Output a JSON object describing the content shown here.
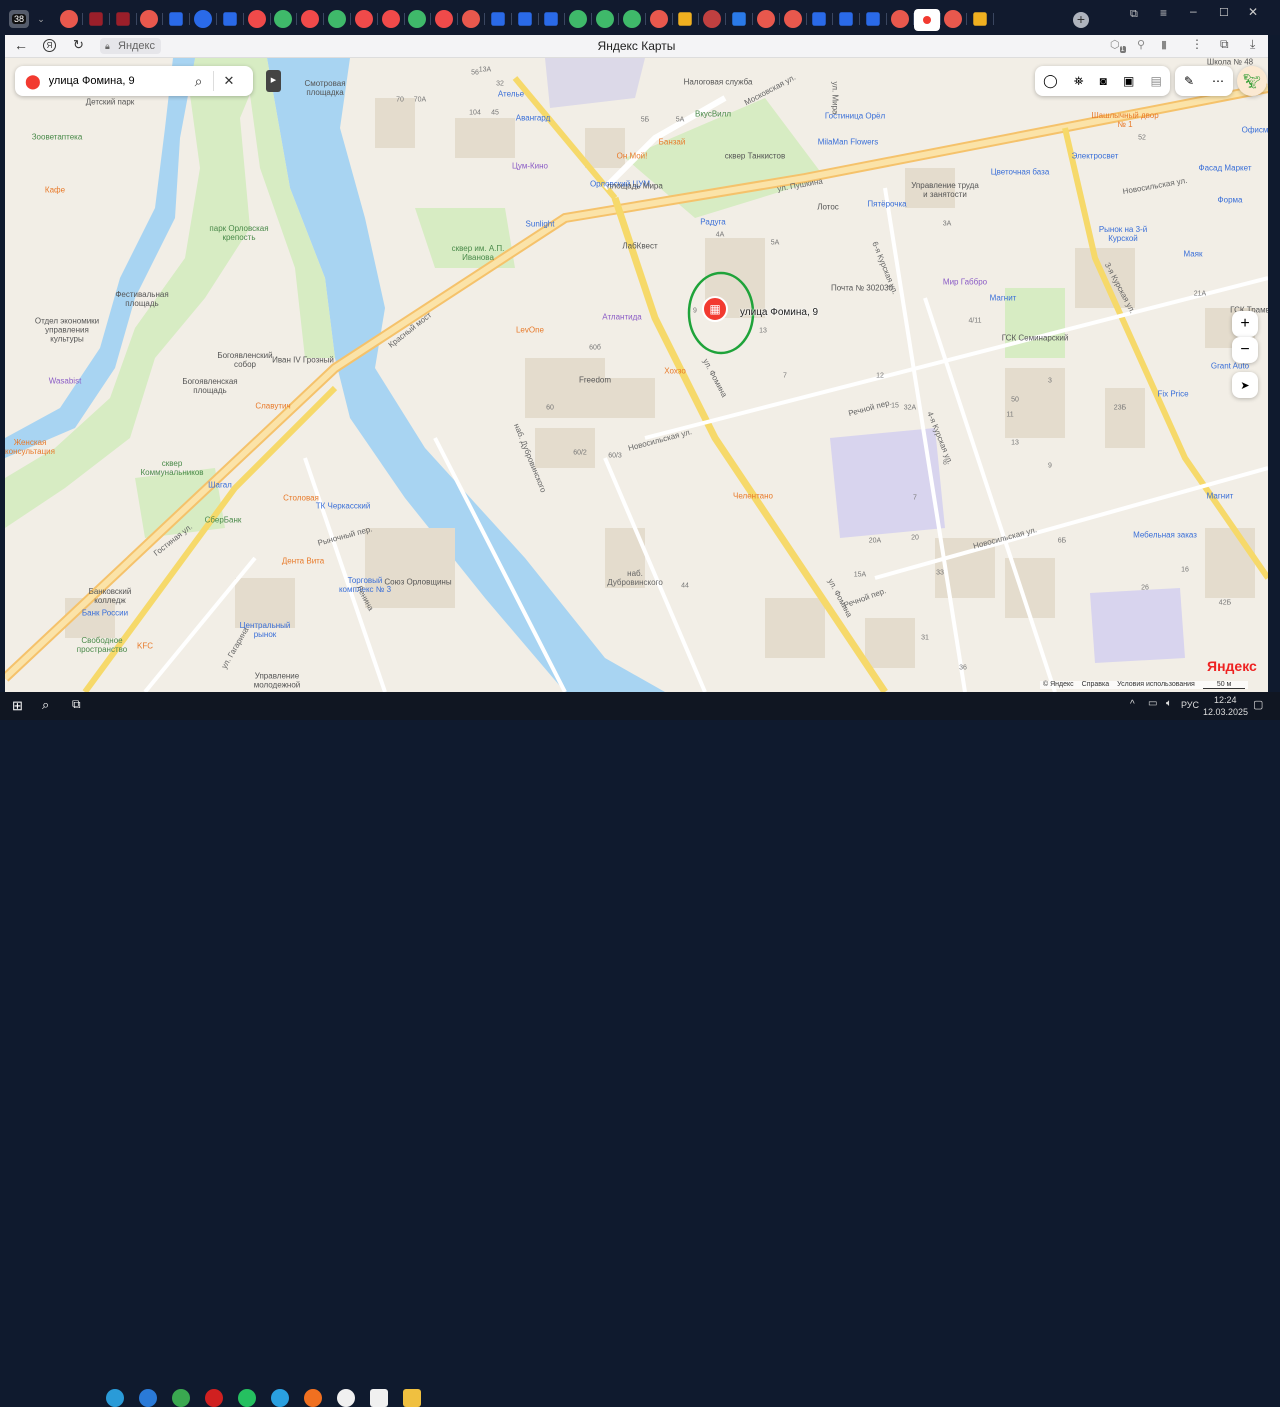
{
  "browser": {
    "tab_count": "38",
    "tabs": [
      "yandex",
      "calendar",
      "calendar",
      "yandex",
      "nav",
      "p1",
      "nav",
      "red-dot",
      "cluster",
      "red-dot",
      "cluster",
      "red-dot",
      "red-dot",
      "cluster",
      "red-dot",
      "yandex",
      "nav",
      "nav",
      "nav",
      "cluster",
      "cluster",
      "cluster",
      "yandex",
      "picture",
      "hoop",
      "vk",
      "yandex",
      "yandex",
      "nav",
      "nav",
      "nav",
      "yandex",
      "yandex-maps-active",
      "yandex",
      "picture"
    ],
    "site_label": "Яндекс",
    "page_title": "Яндекс Карты",
    "address_badge": "1"
  },
  "search": {
    "value": "улица Фомина, 9"
  },
  "marker": {
    "label": "улица Фомина, 9",
    "color": "#f23a30",
    "highlight": "#1fa33a"
  },
  "map_labels": [
    "Смотровая площадка",
    "Ателье",
    "Авангард",
    "Цум-Кино",
    "Орловский ЦУМ",
    "Sunlight",
    "ЛабКвест",
    "Налоговая служба",
    "ВкусВилл",
    "Банзай",
    "Он Мой!",
    "сквер Танкистов",
    "Московская ул.",
    "Гостиница Орёл",
    "MilaMan Flowers",
    "ул. Пушкина",
    "Пятёрочка",
    "Управление труда и занятости",
    "Цветочная база",
    "Лотос",
    "Электросвет",
    "Шашлычный двор № 1",
    "Экспресс Ломбард",
    "Школа № 48",
    "Офисм",
    "Фасад Маркет",
    "Форма",
    "Новосильская ул.",
    "Рынок на 3-й Курской",
    "Маяк",
    "Радуга",
    "Атлантида",
    "LevOne",
    "Freedom",
    "Хохзо",
    "ул. Фомина",
    "Почта № 302030",
    "Мир Габбро",
    "Магнит",
    "ГСК Семинарский",
    "ГСК Трамв",
    "Grant Auto",
    "Fix Price",
    "Красный мост",
    "Иван IV Грозный",
    "Богоявленский собор",
    "Богоявленская площадь",
    "парк Орловская крепость",
    "сквер им. А.П. Иванова",
    "Отдел экономики управления культуры",
    "Фестивальная площадь",
    "Зооветаптека",
    "Кафе",
    "Детский парк",
    "Wasabist",
    "Славутич",
    "Шагал",
    "сквер Коммунальников",
    "Женская консультация",
    "СберБанк",
    "Столовая",
    "ТК Черкасский",
    "Дента Вита",
    "Торговый комплекс № 3",
    "Союз Орловщины",
    "Центральный рынок",
    "Свободное пространство",
    "Банковский колледж",
    "Банк России",
    "KFC",
    "Управление молодежной политики",
    "Гостиная ул.",
    "Челентано",
    "Магнит",
    "Мебельная заказ",
    "Речной пер.",
    "Новосильская ул.",
    "ул. Фомина",
    "4-я Курская ул.",
    "3-я Курская ул.",
    "наб. Дубровинского",
    "наб. Дубровинского",
    "Ленина",
    "Речной пер.",
    "Рыночный пер.",
    "ул. Гагарина",
    "Новосильская ул.",
    "ул. Мира",
    "6-я Курская ул.",
    "площадь Мира"
  ],
  "house_numbers": [
    "13А",
    "70",
    "70А",
    "104",
    "45",
    "32",
    "56",
    "5Б",
    "5А",
    "60б",
    "60/2",
    "60/3",
    "60",
    "9",
    "13",
    "4А",
    "5А",
    "7",
    "12",
    "15",
    "3",
    "11",
    "13",
    "8",
    "9",
    "23Б",
    "20",
    "31",
    "33",
    "36",
    "15А",
    "6Б",
    "26",
    "42Б",
    "21А",
    "33А",
    "52",
    "3А",
    "4/11",
    "44",
    "20А",
    "32А",
    "50",
    "16",
    "7",
    "1",
    "5"
  ],
  "controls": {
    "zoom_in": "+",
    "zoom_out": "−",
    "toolbar_icons": [
      "layers-icon",
      "panorama-icon",
      "camera-icon",
      "transit-icon",
      "traffic-icon",
      "ruler-icon",
      "more-icon"
    ]
  },
  "attribution": {
    "copyright": "© Яндекс",
    "help": "Справка",
    "terms": "Условия использования",
    "scale": "50 м",
    "logo": "Яндекс"
  },
  "taskbar": {
    "tray_lang": "РУС",
    "time": "12:24",
    "date": "12.03.2025"
  }
}
